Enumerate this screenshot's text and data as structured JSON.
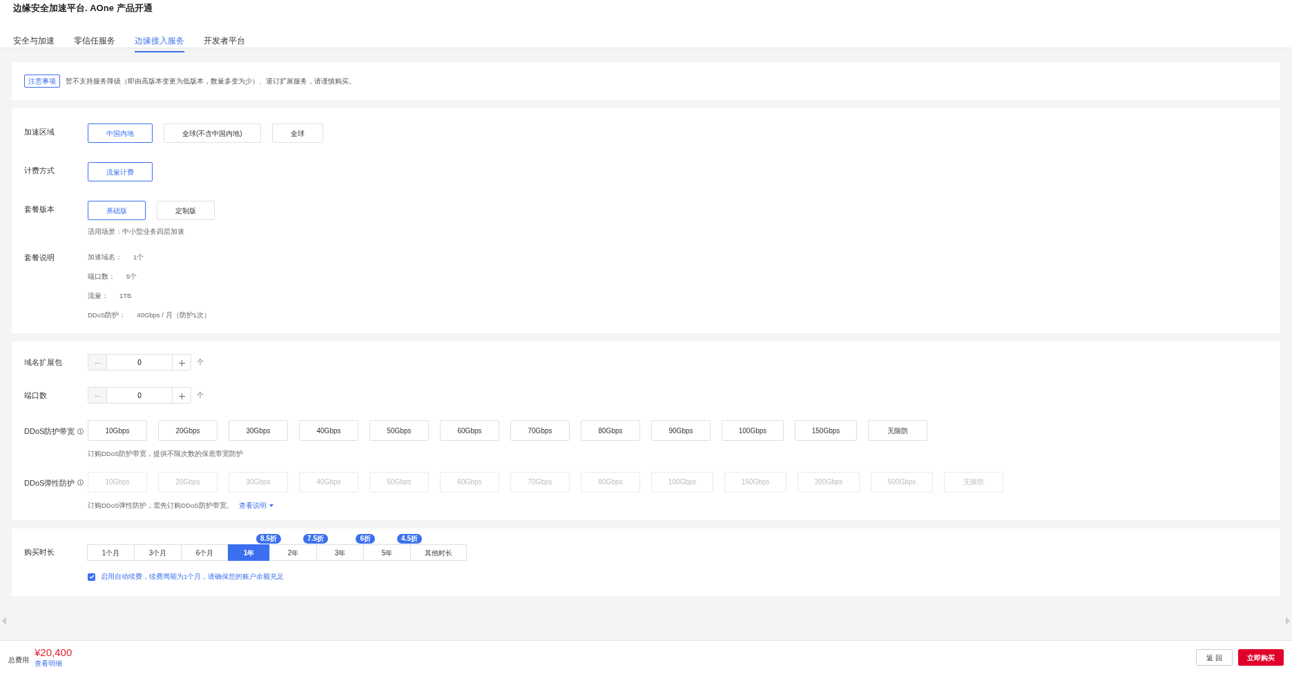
{
  "page_title": "边缘安全加速平台. AOne 产品开通",
  "tabs": [
    {
      "label": "安全与加速",
      "selected": false
    },
    {
      "label": "零信任服务",
      "selected": false
    },
    {
      "label": "边缘接入服务",
      "selected": true
    },
    {
      "label": "开发者平台",
      "selected": false
    }
  ],
  "notice": {
    "tag": "注意事项",
    "text": "暂不支持服务降级（即由高版本变更为低版本，数量多变为少）、退订扩展服务，请谨慎购买。"
  },
  "plan": {
    "rows": [
      {
        "label": "加速区域",
        "options": [
          {
            "label": "中国内地",
            "selected": true
          },
          {
            "label": "全球(不含中国内地)",
            "selected": false
          },
          {
            "label": "全球",
            "selected": false
          }
        ]
      },
      {
        "label": "计费方式",
        "options": [
          {
            "label": "流量计费",
            "selected": true
          }
        ]
      },
      {
        "label": "套餐版本",
        "options": [
          {
            "label": "基础版",
            "selected": true
          },
          {
            "label": "定制版",
            "selected": false
          }
        ],
        "note": "适用场景：中小型业务四层加速"
      }
    ],
    "description": {
      "label": "套餐说明",
      "items": [
        {
          "name": "加速域名：",
          "value": "1个"
        },
        {
          "name": "端口数：",
          "value": "5个"
        },
        {
          "name": "流量：",
          "value": "1TB"
        },
        {
          "name": "DDoS防护：",
          "value": "40Gbps / 月（防护1次）"
        }
      ]
    }
  },
  "addons": {
    "steppers": [
      {
        "label": "域名扩展包",
        "value": "0",
        "unit": "个",
        "decrease_disabled": true
      },
      {
        "label": "端口数",
        "value": "0",
        "unit": "个",
        "decrease_disabled": true
      }
    ],
    "ddos_rows": [
      {
        "label": "DDoS防护带宽",
        "note": "订购DDoS防护带宽，提供不限次数的保底带宽防护",
        "options": [
          {
            "label": "10Gbps",
            "disabled": false
          },
          {
            "label": "20Gbps",
            "disabled": false
          },
          {
            "label": "30Gbps",
            "disabled": false
          },
          {
            "label": "40Gbps",
            "disabled": false
          },
          {
            "label": "50Gbps",
            "disabled": false
          },
          {
            "label": "60Gbps",
            "disabled": false
          },
          {
            "label": "70Gbps",
            "disabled": false
          },
          {
            "label": "80Gbps",
            "disabled": false
          },
          {
            "label": "90Gbps",
            "disabled": false
          },
          {
            "label": "100Gbps",
            "disabled": false
          },
          {
            "label": "150Gbps",
            "disabled": false
          },
          {
            "label": "无限防",
            "disabled": false
          }
        ]
      },
      {
        "label": "DDoS弹性防护",
        "note": "订购DDoS弹性防护，需先订购DDoS防护带宽。",
        "link": "查看说明",
        "options": [
          {
            "label": "10Gbps",
            "disabled": true
          },
          {
            "label": "20Gbps",
            "disabled": true
          },
          {
            "label": "30Gbps",
            "disabled": true
          },
          {
            "label": "40Gbps",
            "disabled": true
          },
          {
            "label": "50Gbps",
            "disabled": true
          },
          {
            "label": "60Gbps",
            "disabled": true
          },
          {
            "label": "70Gbps",
            "disabled": true
          },
          {
            "label": "80Gbps",
            "disabled": true
          },
          {
            "label": "100Gbps",
            "disabled": true
          },
          {
            "label": "150Gbps",
            "disabled": true
          },
          {
            "label": "200Gbps",
            "disabled": true
          },
          {
            "label": "500Gbps",
            "disabled": true
          },
          {
            "label": "无限防",
            "disabled": true
          }
        ]
      }
    ]
  },
  "duration": {
    "label": "购买时长",
    "options": [
      {
        "label": "1个月",
        "selected": false
      },
      {
        "label": "3个月",
        "selected": false
      },
      {
        "label": "6个月",
        "selected": false
      },
      {
        "label": "1年",
        "selected": true,
        "discount": "8.5折"
      },
      {
        "label": "2年",
        "selected": false,
        "discount": "7.5折"
      },
      {
        "label": "3年",
        "selected": false,
        "discount": "6折"
      },
      {
        "label": "5年",
        "selected": false,
        "discount": "4.5折"
      },
      {
        "label": "其他时长",
        "selected": false
      }
    ],
    "auto_renew": {
      "checked": true,
      "text": "启用自动续费，续费周期为1个月，请确保您的账户余额充足"
    }
  },
  "footer": {
    "total_label": "总费用",
    "price": "¥20,400",
    "detail_link": "查看明细",
    "buttons": [
      {
        "label": "返 回",
        "kind": "secondary"
      },
      {
        "label": "立即购买",
        "kind": "primary"
      }
    ]
  }
}
